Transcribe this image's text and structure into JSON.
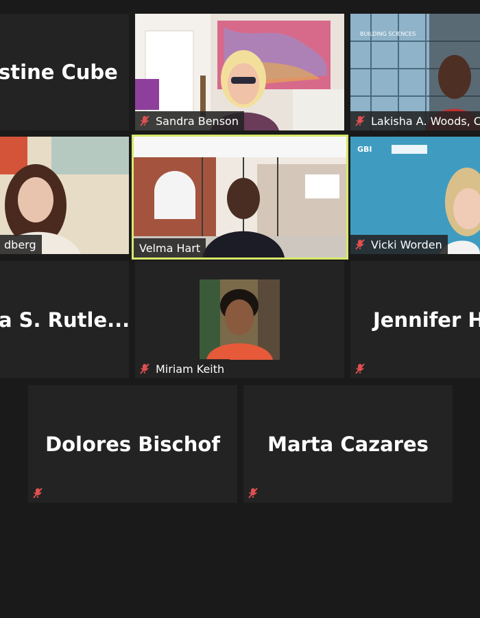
{
  "participants": [
    {
      "id": "christine",
      "display_name": "Christine Cube",
      "visible_name": "stine Cube",
      "video": false
    },
    {
      "id": "sandra",
      "name": "Sandra Benson",
      "video": true,
      "muted": true
    },
    {
      "id": "lakisha",
      "name": "Lakisha A. Woods, C",
      "video": true,
      "muted": true,
      "logo_text": "BUILDING SCIENCES"
    },
    {
      "id": "goldberg",
      "name": "dberg",
      "video": true,
      "muted": false
    },
    {
      "id": "velma",
      "name": "Velma Hart",
      "video": true,
      "muted": false,
      "active_speaker": true
    },
    {
      "id": "vicki",
      "name": "Vicki Worden",
      "video": true,
      "muted": true,
      "logo_text": "GBI"
    },
    {
      "id": "rutledge",
      "display_name": "a S. Rutle...",
      "video": false
    },
    {
      "id": "miriam",
      "name": "Miriam Keith",
      "video": true,
      "muted": true
    },
    {
      "id": "jennifer",
      "display_name": "Jennifer H",
      "video": false,
      "muted": true
    },
    {
      "id": "dolores",
      "display_name": "Dolores Bischof",
      "video": false,
      "muted": true
    },
    {
      "id": "marta",
      "display_name": "Marta Cazares",
      "video": false,
      "muted": true
    }
  ],
  "colors": {
    "background": "#1a1a1a",
    "tile": "#232323",
    "active_border": "#d8e86a",
    "muted_icon": "#e05050"
  },
  "icons": {
    "muted": "mic-off-icon"
  }
}
